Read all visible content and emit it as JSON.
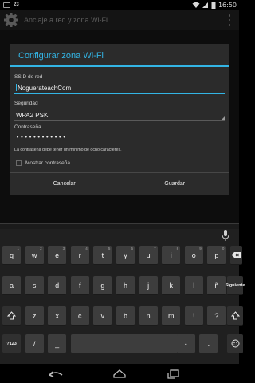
{
  "status_bar": {
    "notification_count": "23",
    "time": "16:50"
  },
  "action_bar": {
    "title": "Anclaje a red y zona Wi-Fi"
  },
  "dialog": {
    "title": "Configurar zona Wi-Fi",
    "ssid_label": "SSID de red",
    "ssid_value": "NoguerateachCom",
    "security_label": "Seguridad",
    "security_value": "WPA2 PSK",
    "password_label": "Contraseña",
    "password_value": "••••••••••••",
    "password_hint": "La contraseña debe tener un mínimo de ocho caracteres.",
    "show_password_label": "Mostrar contraseña",
    "show_password_checked": false,
    "cancel_label": "Cancelar",
    "save_label": "Guardar"
  },
  "keyboard": {
    "row1": [
      {
        "key": "q",
        "digit": "1"
      },
      {
        "key": "w",
        "digit": "2"
      },
      {
        "key": "e",
        "digit": "3"
      },
      {
        "key": "r",
        "digit": "4"
      },
      {
        "key": "t",
        "digit": "5"
      },
      {
        "key": "y",
        "digit": "6"
      },
      {
        "key": "u",
        "digit": "7"
      },
      {
        "key": "i",
        "digit": "8"
      },
      {
        "key": "o",
        "digit": "9"
      },
      {
        "key": "p",
        "digit": "0"
      }
    ],
    "row2": [
      "a",
      "s",
      "d",
      "f",
      "g",
      "h",
      "j",
      "k",
      "l",
      "ñ"
    ],
    "row3": [
      "z",
      "x",
      "c",
      "v",
      "b",
      "n",
      "m",
      "!",
      "?"
    ],
    "row4": {
      "symbols": "?123",
      "slash": "/",
      "dash": "_",
      "dash2": "-",
      "period": "."
    },
    "next_label": "Siguiente",
    "icons": [
      "microphone-icon",
      "backspace-icon",
      "shift-icon",
      "emoji-icon"
    ]
  },
  "nav_bar": {
    "icons": [
      "back-icon",
      "home-icon",
      "recent-apps-icon"
    ]
  },
  "colors": {
    "accent": "#33b5e5",
    "dialog_bg": "#2b2b2b",
    "keyboard_bg": "#202020",
    "key_bg": "#3d3d3d"
  }
}
